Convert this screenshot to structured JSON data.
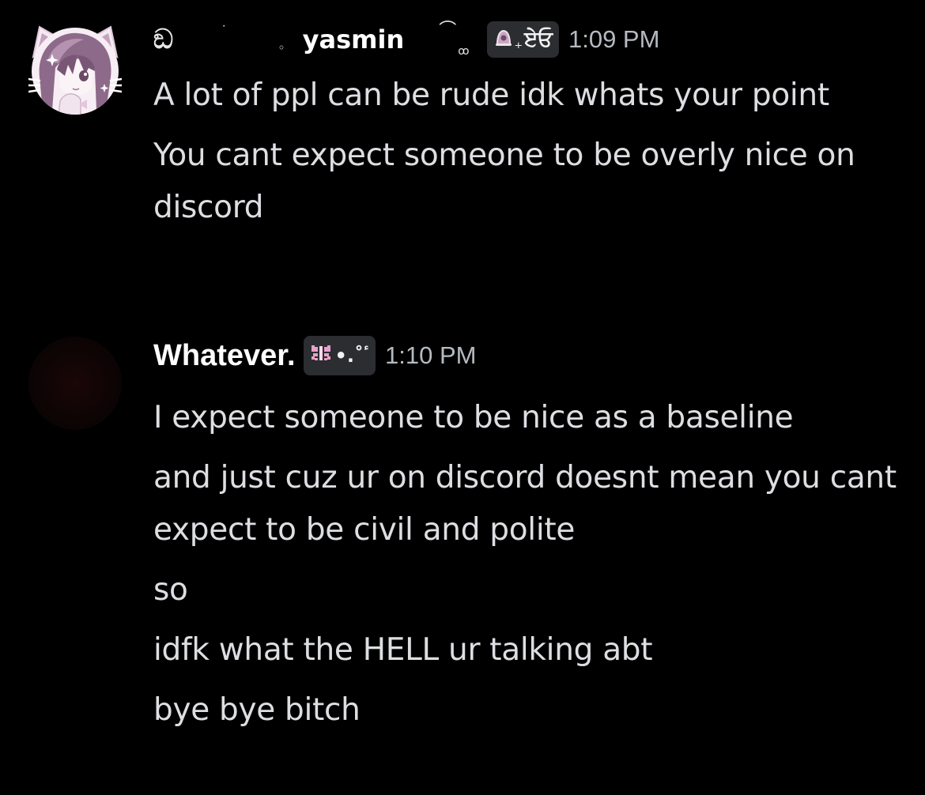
{
  "messages": [
    {
      "deco_prefix": "ඞ",
      "deco_dot": "˙",
      "deco_circle": "◦",
      "username": "yasmin",
      "name_deco_hook": "⌒",
      "name_deco_oo": "ꝏ",
      "tag_text": "ਏਓ",
      "tag_plus": "₊",
      "timestamp": "1:09 PM",
      "avatar": "anime-girl-cat-ears-avatar",
      "paragraphs": [
        "A lot of ppl can be rude idk whats your point",
        "You cant expect someone to be overly nice on discord"
      ]
    },
    {
      "username": "Whatever.",
      "tag_text": "•.˚ٴ",
      "timestamp": "1:10 PM",
      "avatar": "dark-avatar",
      "paragraphs": [
        "I expect someone to be nice as a baseline",
        "and just cuz ur on discord doesnt mean you cant expect to be civil and polite",
        "so",
        "idfk what the HELL ur talking abt",
        "bye bye bitch"
      ]
    }
  ],
  "colors": {
    "background": "#000000",
    "username": "#ffffff",
    "message_text": "#dddee2",
    "timestamp": "#b5bac1",
    "tag_background": "#2b2d31",
    "butterfly_accent": "#e8a0c8"
  }
}
